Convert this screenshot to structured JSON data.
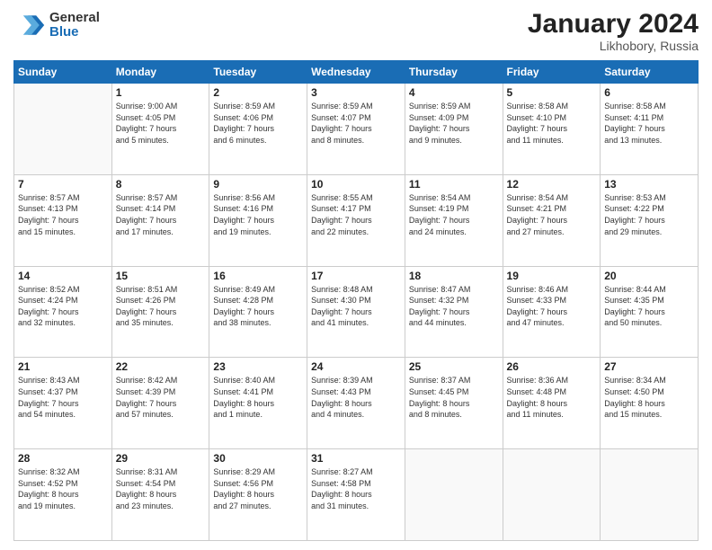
{
  "header": {
    "logo_general": "General",
    "logo_blue": "Blue",
    "title": "January 2024",
    "location": "Likhobory, Russia"
  },
  "weekdays": [
    "Sunday",
    "Monday",
    "Tuesday",
    "Wednesday",
    "Thursday",
    "Friday",
    "Saturday"
  ],
  "weeks": [
    [
      {
        "day": "",
        "info": ""
      },
      {
        "day": "1",
        "info": "Sunrise: 9:00 AM\nSunset: 4:05 PM\nDaylight: 7 hours\nand 5 minutes."
      },
      {
        "day": "2",
        "info": "Sunrise: 8:59 AM\nSunset: 4:06 PM\nDaylight: 7 hours\nand 6 minutes."
      },
      {
        "day": "3",
        "info": "Sunrise: 8:59 AM\nSunset: 4:07 PM\nDaylight: 7 hours\nand 8 minutes."
      },
      {
        "day": "4",
        "info": "Sunrise: 8:59 AM\nSunset: 4:09 PM\nDaylight: 7 hours\nand 9 minutes."
      },
      {
        "day": "5",
        "info": "Sunrise: 8:58 AM\nSunset: 4:10 PM\nDaylight: 7 hours\nand 11 minutes."
      },
      {
        "day": "6",
        "info": "Sunrise: 8:58 AM\nSunset: 4:11 PM\nDaylight: 7 hours\nand 13 minutes."
      }
    ],
    [
      {
        "day": "7",
        "info": "Sunrise: 8:57 AM\nSunset: 4:13 PM\nDaylight: 7 hours\nand 15 minutes."
      },
      {
        "day": "8",
        "info": "Sunrise: 8:57 AM\nSunset: 4:14 PM\nDaylight: 7 hours\nand 17 minutes."
      },
      {
        "day": "9",
        "info": "Sunrise: 8:56 AM\nSunset: 4:16 PM\nDaylight: 7 hours\nand 19 minutes."
      },
      {
        "day": "10",
        "info": "Sunrise: 8:55 AM\nSunset: 4:17 PM\nDaylight: 7 hours\nand 22 minutes."
      },
      {
        "day": "11",
        "info": "Sunrise: 8:54 AM\nSunset: 4:19 PM\nDaylight: 7 hours\nand 24 minutes."
      },
      {
        "day": "12",
        "info": "Sunrise: 8:54 AM\nSunset: 4:21 PM\nDaylight: 7 hours\nand 27 minutes."
      },
      {
        "day": "13",
        "info": "Sunrise: 8:53 AM\nSunset: 4:22 PM\nDaylight: 7 hours\nand 29 minutes."
      }
    ],
    [
      {
        "day": "14",
        "info": "Sunrise: 8:52 AM\nSunset: 4:24 PM\nDaylight: 7 hours\nand 32 minutes."
      },
      {
        "day": "15",
        "info": "Sunrise: 8:51 AM\nSunset: 4:26 PM\nDaylight: 7 hours\nand 35 minutes."
      },
      {
        "day": "16",
        "info": "Sunrise: 8:49 AM\nSunset: 4:28 PM\nDaylight: 7 hours\nand 38 minutes."
      },
      {
        "day": "17",
        "info": "Sunrise: 8:48 AM\nSunset: 4:30 PM\nDaylight: 7 hours\nand 41 minutes."
      },
      {
        "day": "18",
        "info": "Sunrise: 8:47 AM\nSunset: 4:32 PM\nDaylight: 7 hours\nand 44 minutes."
      },
      {
        "day": "19",
        "info": "Sunrise: 8:46 AM\nSunset: 4:33 PM\nDaylight: 7 hours\nand 47 minutes."
      },
      {
        "day": "20",
        "info": "Sunrise: 8:44 AM\nSunset: 4:35 PM\nDaylight: 7 hours\nand 50 minutes."
      }
    ],
    [
      {
        "day": "21",
        "info": "Sunrise: 8:43 AM\nSunset: 4:37 PM\nDaylight: 7 hours\nand 54 minutes."
      },
      {
        "day": "22",
        "info": "Sunrise: 8:42 AM\nSunset: 4:39 PM\nDaylight: 7 hours\nand 57 minutes."
      },
      {
        "day": "23",
        "info": "Sunrise: 8:40 AM\nSunset: 4:41 PM\nDaylight: 8 hours\nand 1 minute."
      },
      {
        "day": "24",
        "info": "Sunrise: 8:39 AM\nSunset: 4:43 PM\nDaylight: 8 hours\nand 4 minutes."
      },
      {
        "day": "25",
        "info": "Sunrise: 8:37 AM\nSunset: 4:45 PM\nDaylight: 8 hours\nand 8 minutes."
      },
      {
        "day": "26",
        "info": "Sunrise: 8:36 AM\nSunset: 4:48 PM\nDaylight: 8 hours\nand 11 minutes."
      },
      {
        "day": "27",
        "info": "Sunrise: 8:34 AM\nSunset: 4:50 PM\nDaylight: 8 hours\nand 15 minutes."
      }
    ],
    [
      {
        "day": "28",
        "info": "Sunrise: 8:32 AM\nSunset: 4:52 PM\nDaylight: 8 hours\nand 19 minutes."
      },
      {
        "day": "29",
        "info": "Sunrise: 8:31 AM\nSunset: 4:54 PM\nDaylight: 8 hours\nand 23 minutes."
      },
      {
        "day": "30",
        "info": "Sunrise: 8:29 AM\nSunset: 4:56 PM\nDaylight: 8 hours\nand 27 minutes."
      },
      {
        "day": "31",
        "info": "Sunrise: 8:27 AM\nSunset: 4:58 PM\nDaylight: 8 hours\nand 31 minutes."
      },
      {
        "day": "",
        "info": ""
      },
      {
        "day": "",
        "info": ""
      },
      {
        "day": "",
        "info": ""
      }
    ]
  ]
}
